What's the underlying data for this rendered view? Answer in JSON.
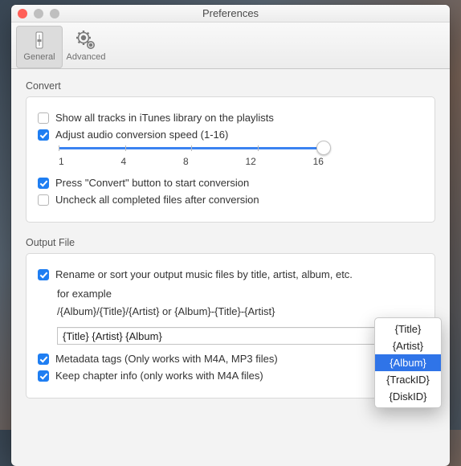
{
  "window": {
    "title": "Preferences"
  },
  "toolbar": {
    "general": "General",
    "advanced": "Advanced"
  },
  "convert": {
    "group_label": "Convert",
    "show_all": {
      "checked": false,
      "label": "Show all tracks in iTunes library on the playlists"
    },
    "adjust_speed": {
      "checked": true,
      "label": "Adjust audio conversion speed (1-16)"
    },
    "slider": {
      "min": 1,
      "max": 16,
      "value": 16,
      "ticks": [
        "1",
        "4",
        "8",
        "12",
        "16"
      ]
    },
    "press_convert": {
      "checked": true,
      "label": "Press \"Convert\" button to start conversion"
    },
    "uncheck_completed": {
      "checked": false,
      "label": "Uncheck all completed files after conversion"
    }
  },
  "output": {
    "group_label": "Output File",
    "rename": {
      "checked": true,
      "label": "Rename or sort your output music files by title, artist, album, etc."
    },
    "example_intro": "for example",
    "example_pattern": "/{Album}/{Title}/{Artist} or {Album}-{Title}-{Artist}",
    "pattern_value": "{Title} {Artist} {Album}",
    "metadata": {
      "checked": true,
      "label": "Metadata tags (Only works with M4A, MP3 files)"
    },
    "chapter": {
      "checked": true,
      "label": "Keep chapter info (only works with  M4A files)"
    }
  },
  "tag_picker": {
    "items": [
      "{Title}",
      "{Artist}",
      "{Album}",
      "{TrackID}",
      "{DiskID}"
    ],
    "selected_index": 2
  }
}
